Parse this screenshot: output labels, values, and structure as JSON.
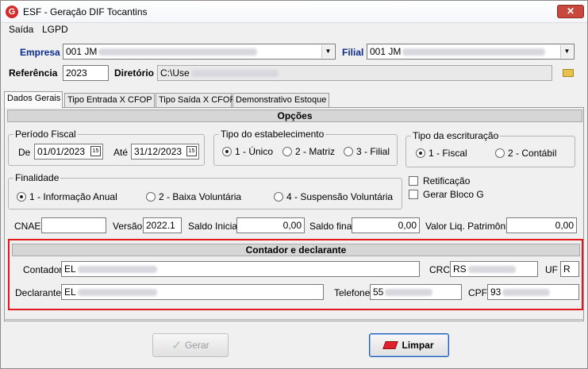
{
  "window": {
    "title": "ESF - Geração DIF Tocantins",
    "close_label": "✕"
  },
  "menu": [
    "Saída",
    "LGPD"
  ],
  "header": {
    "empresa_label": "Empresa",
    "empresa_value": "001 JM",
    "filial_label": "Filial",
    "filial_value": "001 JM",
    "referencia_label": "Referência",
    "referencia_value": "2023",
    "diretorio_label": "Diretório",
    "diretorio_value": "C:\\Use"
  },
  "tabs": [
    "Dados Gerais",
    "Tipo Entrada X CFOP",
    "Tipo Saída X CFOP",
    "Demonstrativo Estoque"
  ],
  "options": {
    "section_title": "Opções",
    "periodo": {
      "title": "Período Fiscal",
      "de_label": "De",
      "de_value": "01/01/2023",
      "ate_label": "Até",
      "ate_value": "31/12/2023",
      "cal_glyph": "15"
    },
    "estabelecimento": {
      "title": "Tipo do estabelecimento",
      "options": [
        "1 - Único",
        "2 - Matriz",
        "3 - Filial"
      ],
      "selected": 0
    },
    "escrituracao": {
      "title": "Tipo da escrituração",
      "options": [
        "1 - Fiscal",
        "2 - Contábil"
      ],
      "selected": 0
    },
    "finalidade": {
      "title": "Finalidade",
      "options": [
        "1 - Informação Anual",
        "2 - Baixa Voluntária",
        "4 - Suspensão Voluntária"
      ],
      "selected": 0
    },
    "retificacao_label": "Retificação",
    "gerar_bloco_label": "Gerar Bloco G",
    "cnae_label": "CNAE",
    "cnae_value": "",
    "versao_label": "Versão",
    "versao_value": "2022.1",
    "saldo_inicial_label": "Saldo Inicial",
    "saldo_inicial_value": "0,00",
    "saldo_final_label": "Saldo final",
    "saldo_final_value": "0,00",
    "valor_liq_label": "Valor Liq. Patrimônio",
    "valor_liq_value": "0,00"
  },
  "contador": {
    "section_title": "Contador e declarante",
    "contador_label": "Contador",
    "contador_value": "EL",
    "crc_label": "CRC",
    "crc_value": "RS",
    "uf_label": "UF",
    "uf_value": "R",
    "declarante_label": "Declarante",
    "declarante_value": "EL",
    "telefone_label": "Telefone",
    "telefone_value": "55",
    "cpf_label": "CPF",
    "cpf_value": "93"
  },
  "buttons": {
    "gerar_label": "Gerar",
    "limpar_label": "Limpar"
  }
}
